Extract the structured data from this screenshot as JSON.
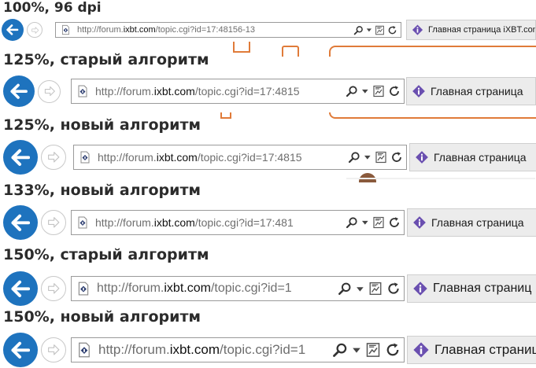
{
  "rows": [
    {
      "caption": "100%, 96 dpi",
      "url_prefix": "http://forum.",
      "url_domain": "ixbt.com",
      "url_suffix": "/topic.cgi?id=17:48156-13",
      "tab_title": "Главная страница iXBT.com"
    },
    {
      "caption": "125%, старый алгоритм",
      "url_prefix": "http://forum.",
      "url_domain": "ixbt.com",
      "url_suffix": "/topic.cgi?id=17:4815",
      "tab_title": "Главная страница"
    },
    {
      "caption": "125%, новый алгоритм",
      "url_prefix": "http://forum.",
      "url_domain": "ixbt.com",
      "url_suffix": "/topic.cgi?id=17:4815",
      "tab_title": "Главная страница"
    },
    {
      "caption": "133%, новый алгоритм",
      "url_prefix": "http://forum.",
      "url_domain": "ixbt.com",
      "url_suffix": "/topic.cgi?id=17:481",
      "tab_title": "Главная страница"
    },
    {
      "caption": "150%, старый алгоритм",
      "url_prefix": "http://forum.",
      "url_domain": "ixbt.com",
      "url_suffix": "/topic.cgi?id=1",
      "tab_title": "Главная страниц"
    },
    {
      "caption": "150%, новый алгоритм",
      "url_prefix": "http://forum.",
      "url_domain": "ixbt.com",
      "url_suffix": "/topic.cgi?id=1",
      "tab_title": "Главная страниц"
    }
  ],
  "icons": {
    "back": "back-arrow-icon",
    "forward": "forward-arrow-icon",
    "favicon": "site-favicon-icon",
    "search": "search-icon",
    "dropdown": "chevron-down-icon",
    "compat": "compatibility-view-icon",
    "refresh": "refresh-icon",
    "tab": "ixbt-tab-icon"
  },
  "colors": {
    "back_button": "#1e73be",
    "tab_icon": "#6a4fb0",
    "page_accent": "#e07b39"
  }
}
